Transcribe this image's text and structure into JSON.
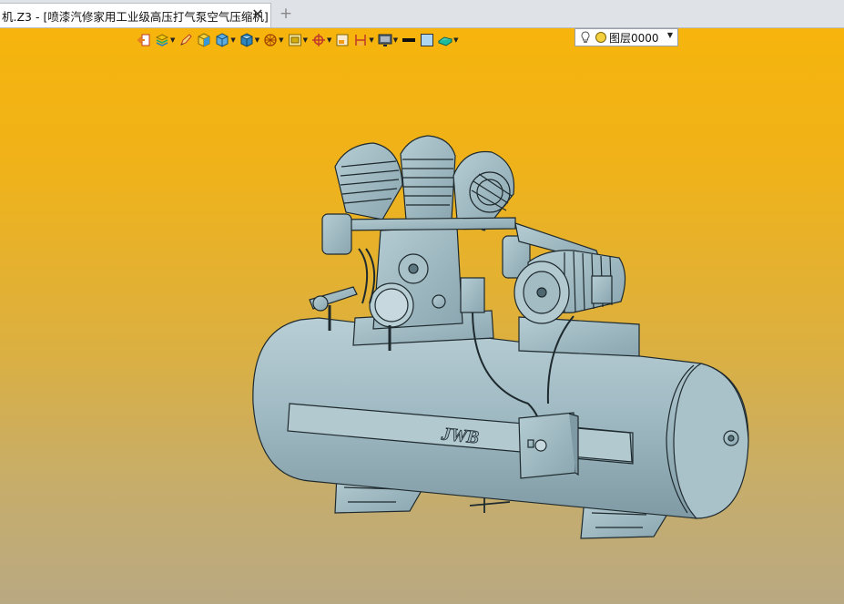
{
  "tab": {
    "title": "机.Z3 - [喷漆汽修家用工业级高压打气泵空气压缩机]",
    "close_glyph": "✕",
    "new_tab_glyph": "+"
  },
  "toolbar": {
    "items": [
      {
        "name": "exit-icon",
        "dropdown": false
      },
      {
        "name": "layers-stack-icon",
        "dropdown": true
      },
      {
        "name": "pencil-icon",
        "dropdown": false
      },
      {
        "name": "cube-yellow-icon",
        "dropdown": false
      },
      {
        "name": "cube-blue-icon",
        "dropdown": true
      },
      {
        "name": "view-cube-icon",
        "dropdown": true
      },
      {
        "name": "wireframe-sphere-icon",
        "dropdown": true
      },
      {
        "name": "render-mode-icon",
        "dropdown": true
      },
      {
        "name": "crosshair-target-icon",
        "dropdown": true
      },
      {
        "name": "frame-icon",
        "dropdown": false
      },
      {
        "name": "dimension-icon",
        "dropdown": true
      },
      {
        "name": "monitor-icon",
        "dropdown": true
      },
      {
        "name": "line-color-swatch",
        "dropdown": false
      },
      {
        "name": "fill-color-swatch",
        "dropdown": false
      },
      {
        "name": "plane-icon",
        "dropdown": true
      }
    ],
    "layer": {
      "label": "图层0000",
      "arrow_glyph": "▼"
    }
  },
  "model": {
    "badge_text": "JWB"
  },
  "colors": {
    "viewport_top": "#f6b40c",
    "viewport_bottom": "#b9a982",
    "model_fill": "#9fb9c2",
    "model_edge": "#1e2a2e"
  }
}
